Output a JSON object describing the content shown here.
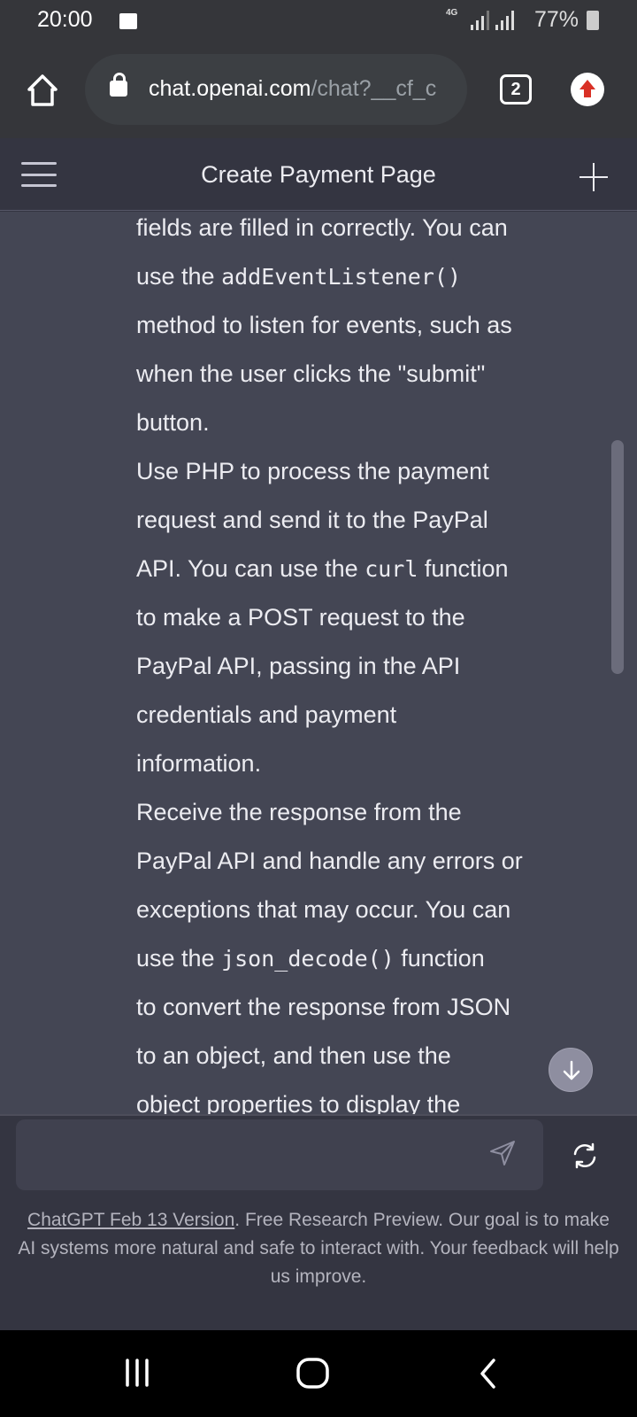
{
  "status_bar": {
    "time": "20:00",
    "network": "4G",
    "battery": "77%"
  },
  "browser": {
    "url_host": "chat.openai.com",
    "url_path": "/chat?__cf_c",
    "tab_count": "2"
  },
  "chat_header": {
    "title": "Create Payment Page"
  },
  "message_lines": [
    [
      {
        "t": "fields are filled in correctly. You can"
      }
    ],
    [
      {
        "t": "use the "
      },
      {
        "t": "addEventListener()",
        "code": true
      }
    ],
    [
      {
        "t": "method to listen for events, such as"
      }
    ],
    [
      {
        "t": "when the user clicks the \"submit\""
      }
    ],
    [
      {
        "t": "button."
      }
    ],
    [
      {
        "t": "Use PHP to process the payment"
      }
    ],
    [
      {
        "t": "request and send it to the PayPal"
      }
    ],
    [
      {
        "t": "API. You can use the "
      },
      {
        "t": "curl",
        "code": true
      },
      {
        "t": " function"
      }
    ],
    [
      {
        "t": "to make a POST request to the"
      }
    ],
    [
      {
        "t": "PayPal API, passing in the API"
      }
    ],
    [
      {
        "t": "credentials and payment"
      }
    ],
    [
      {
        "t": "information."
      }
    ],
    [
      {
        "t": "Receive the response from the"
      }
    ],
    [
      {
        "t": "PayPal API and handle any errors or"
      }
    ],
    [
      {
        "t": "exceptions that may occur. You can"
      }
    ],
    [
      {
        "t": "use the "
      },
      {
        "t": "json_decode()",
        "code": true
      },
      {
        "t": " function"
      }
    ],
    [
      {
        "t": "to convert the response from JSON"
      }
    ],
    [
      {
        "t": "to an object, and then use the"
      }
    ],
    [
      {
        "t": "object properties to display the"
      }
    ]
  ],
  "composer": {
    "placeholder": ""
  },
  "footer": {
    "link": "ChatGPT Feb 13 Version",
    "text": ". Free Research Preview. Our goal is to make AI systems more natural and safe to interact with. Your feedback will help us improve."
  },
  "colors": {
    "content_bg": "#444654",
    "header_bg": "#343541",
    "update_badge": "#d93025"
  }
}
